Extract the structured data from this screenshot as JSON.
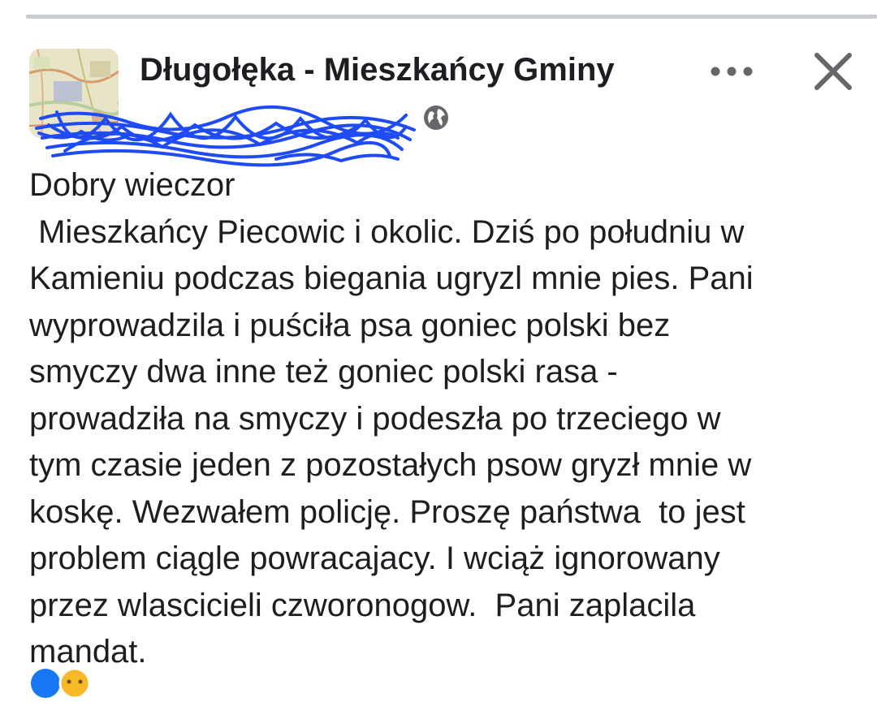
{
  "header": {
    "group_name": "Długołęka - Mieszkańcy Gminy",
    "more_icon": "more-horizontal-icon",
    "close_icon": "close-icon",
    "privacy_icon": "globe-icon"
  },
  "post": {
    "lines": [
      "Dobry wieczor",
      " Mieszkańcy Piecowic i okolic. Dziś po południu w",
      "Kamieniu podczas biegania ugryzl mnie pies. Pani",
      "wyprowadzila i puściła psa goniec polski bez",
      "smyczy dwa inne też goniec polski rasa -",
      "prowadziła na smyczy i podeszła po trzeciego w",
      "tym czasie jeden z pozostałych psow gryzł mnie w",
      "koskę. Wezwałem policję. Proszę państwa  to jest",
      "problem ciągle powracajacy. I wciąż ignorowany",
      "przez wlascicieli czworonogow.  Pani zaplacila",
      "mandat."
    ]
  },
  "colors": {
    "text": "#1c1e21",
    "scribble": "#1f4bf5",
    "icon_gray": "#65676b",
    "reaction_blue": "#1877f2",
    "reaction_yellow": "#f7b928"
  }
}
